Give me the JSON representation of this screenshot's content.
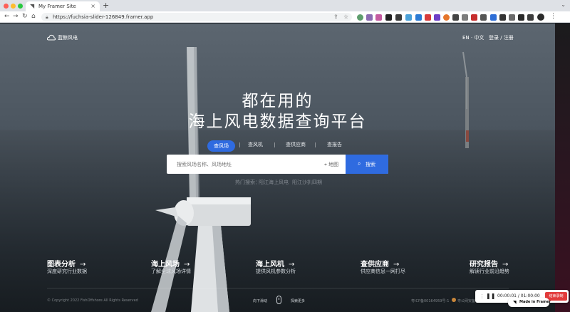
{
  "browser": {
    "tab_title": "My Framer Site",
    "tab_close": "×",
    "new_tab": "+",
    "tab_menu": "⌄",
    "url": "https://fuchsia-slider-126849.framer.app",
    "back": "←",
    "forward": "→",
    "reload": "↻",
    "home": "⌂",
    "share_icon": "⇪",
    "star_icon": "☆",
    "menu": "⋮"
  },
  "header": {
    "logo": "蓝鲸风电",
    "lang": "EN · 中文",
    "login": "登录 / 注册"
  },
  "hero": {
    "line1": "都在用的",
    "line2": "海上风电数据查询平台"
  },
  "search": {
    "tabs": [
      "查风场",
      "查风机",
      "查供应商",
      "查报告"
    ],
    "placeholder": "搜索风场名称、风场地址",
    "map_label": "地图",
    "button": "搜索",
    "hot_label": "热门搜索：",
    "hot_items": [
      "阳江海上风电",
      "阳江沙扒四期"
    ]
  },
  "features": [
    {
      "title": "图表分析",
      "desc": "深度研究行业数据"
    },
    {
      "title": "海上风场",
      "desc": "了解全球风场详情"
    },
    {
      "title": "海上风机",
      "desc": "提供风机参数分析"
    },
    {
      "title": "查供应商",
      "desc": "供应商信息一网打尽"
    },
    {
      "title": "研究报告",
      "desc": "解读行业前沿趋势"
    }
  ],
  "footer": {
    "copyright": "© Copyright 2022 FishOffshore All Rights Reserved",
    "scroll_down": "向下滑动",
    "explore": "探索更多",
    "icp": "粤ICP备00164959号-1",
    "icp2": "粤公网安备"
  },
  "video": {
    "grip": "⋮",
    "pause": "❚❚",
    "time": "00:00:01 / 01:00:00",
    "stop": "结束录制"
  },
  "framer_badge": {
    "icon": "◥",
    "label": "Made in Framer"
  },
  "colors": {
    "accent": "#2f6be0",
    "stop": "#e23b3b"
  }
}
